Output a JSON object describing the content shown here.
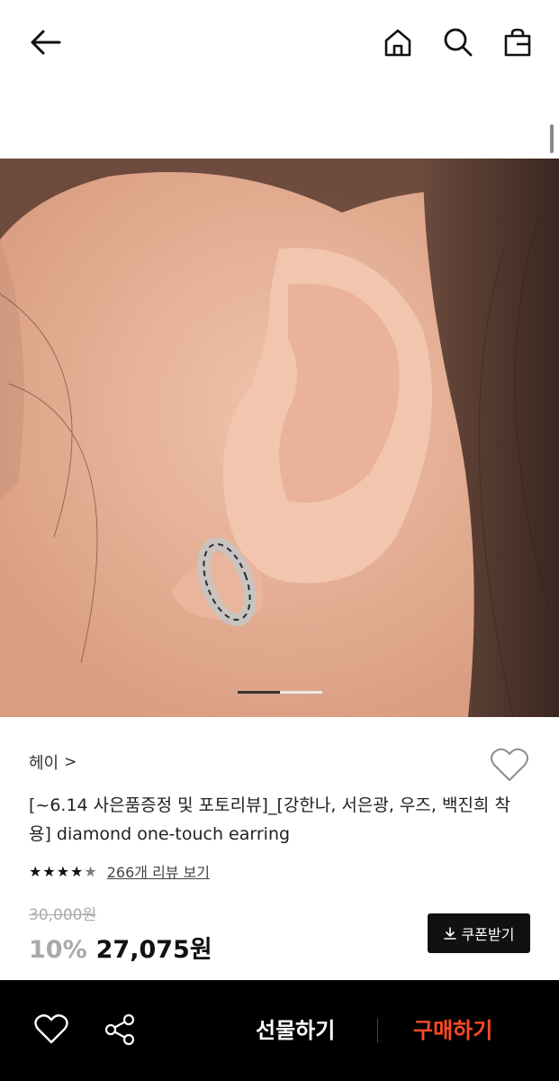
{
  "header": {
    "back_icon": "arrow-left-icon",
    "home_icon": "home-icon",
    "search_icon": "search-icon",
    "bag_icon": "shopping-bag-icon"
  },
  "product": {
    "brand": "헤이",
    "brand_chevron": ">",
    "title": "[~6.14 사은품증정 및 포토리뷰]_[강한나, 서은광, 우즈, 백진희 착용] diamond one-touch earring",
    "image_index": 1,
    "image_count": 2,
    "rating_stars": 4.5,
    "review_link": "266개 리뷰 보기",
    "original_price": "30,000원",
    "discount": "10%",
    "price": "27,075원",
    "coupon_label": "쿠폰받기",
    "coupon_icon": "download-icon"
  },
  "bottom_bar": {
    "heart_icon": "heart-icon",
    "share_icon": "share-icon",
    "gift_label": "선물하기",
    "buy_label": "구매하기",
    "buy_color": "#ff4b24"
  }
}
